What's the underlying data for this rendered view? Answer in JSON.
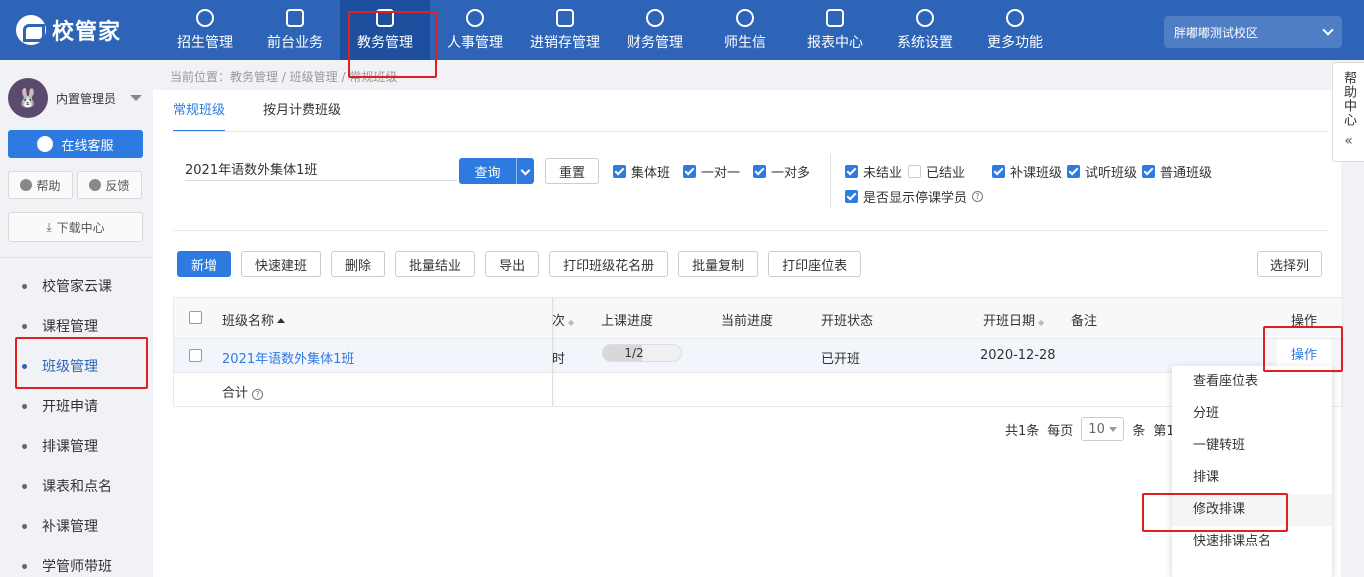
{
  "app": {
    "logo_text": "校管家"
  },
  "nav": [
    {
      "label": "招生管理",
      "icon": "add-user-icon"
    },
    {
      "label": "前台业务",
      "icon": "monitor-icon"
    },
    {
      "label": "教务管理",
      "icon": "book-icon"
    },
    {
      "label": "人事管理",
      "icon": "person-icon"
    },
    {
      "label": "进销存管理",
      "icon": "inventory-icon"
    },
    {
      "label": "财务管理",
      "icon": "finance-icon"
    },
    {
      "label": "师生信",
      "icon": "chat-icon"
    },
    {
      "label": "报表中心",
      "icon": "report-icon"
    },
    {
      "label": "系统设置",
      "icon": "gear-icon"
    },
    {
      "label": "更多功能",
      "icon": "more-icon"
    }
  ],
  "campus": "胖嘟嘟测试校区",
  "user": {
    "name": "内置管理员"
  },
  "sidebar": {
    "kefu": "在线客服",
    "help": "帮助",
    "feedback": "反馈",
    "download": "下载中心",
    "items": [
      "校管家云课",
      "课程管理",
      "班级管理",
      "开班申请",
      "排课管理",
      "课表和点名",
      "补课管理",
      "学管师带班"
    ]
  },
  "breadcrumb": "当前位置：教务管理 / 班级管理 / 常规班级",
  "tabs": [
    "常规班级",
    "按月计费班级"
  ],
  "filters": {
    "search_value": "2021年语数外集体1班",
    "query": "查询",
    "reset": "重置",
    "type1": "集体班",
    "type2": "一对一",
    "type3": "一对多",
    "status1": "未结业",
    "status2": "已结业",
    "show_stopped": "是否显示停课学员",
    "kind1": "补课班级",
    "kind2": "试听班级",
    "kind3": "普通班级"
  },
  "toolbar": [
    "新增",
    "快速建班",
    "删除",
    "批量结业",
    "导出",
    "打印班级花名册",
    "批量复制",
    "打印座位表"
  ],
  "column_select": "选择列",
  "table": {
    "headers": {
      "name": "班级名称",
      "partial": "次",
      "progress": "上课进度",
      "current": "当前进度",
      "status": "开班状态",
      "date": "开班日期",
      "note": "备注",
      "ops": "操作"
    },
    "row": {
      "name": "2021年语数外集体1班",
      "partial": "时",
      "progress_text": "1/2",
      "progress_fraction": 0.5,
      "status": "已开班",
      "date": "2020-12-28",
      "ops": "操作"
    },
    "total_label": "合计"
  },
  "pager": {
    "total": "共1条",
    "per_page_label": "每页",
    "per_page": "10",
    "unit": "条",
    "page": "第1,"
  },
  "ops_menu": [
    "查看座位表",
    "分班",
    "一键转班",
    "排课",
    "修改排课",
    "快速排课点名"
  ],
  "help_center": "帮助中心"
}
